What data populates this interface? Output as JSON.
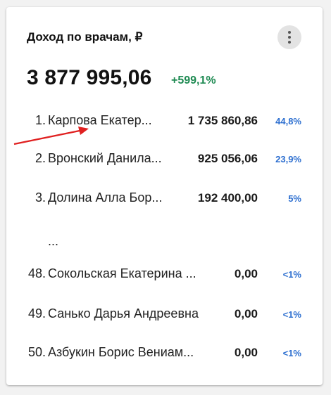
{
  "widget": {
    "title": "Доход по врачам, ₽",
    "total": "3 877 995,06",
    "delta": "+599,1%",
    "ellipsis": "...",
    "menu_icon": "more-vert-icon"
  },
  "rows": [
    {
      "rank": "1.",
      "name": "Карпова Екатер...",
      "amount": "1 735 860,86",
      "share": "44,8%"
    },
    {
      "rank": "2.",
      "name": "Вронский Данила...",
      "amount": "925 056,06",
      "share": "23,9%"
    },
    {
      "rank": "3.",
      "name": "Долина Алла Бор...",
      "amount": "192 400,00",
      "share": "5%"
    },
    {
      "rank": "48.",
      "name": "Сокольская Екатерина ...",
      "amount": "0,00",
      "share": "<1%"
    },
    {
      "rank": "49.",
      "name": "Санько Дарья Андреевна",
      "amount": "0,00",
      "share": "<1%"
    },
    {
      "rank": "50.",
      "name": "Азбукин Борис Вениам...",
      "amount": "0,00",
      "share": "<1%"
    }
  ],
  "colors": {
    "delta": "#1e8a52",
    "share": "#2d6fd0",
    "arrow": "#e02020"
  }
}
